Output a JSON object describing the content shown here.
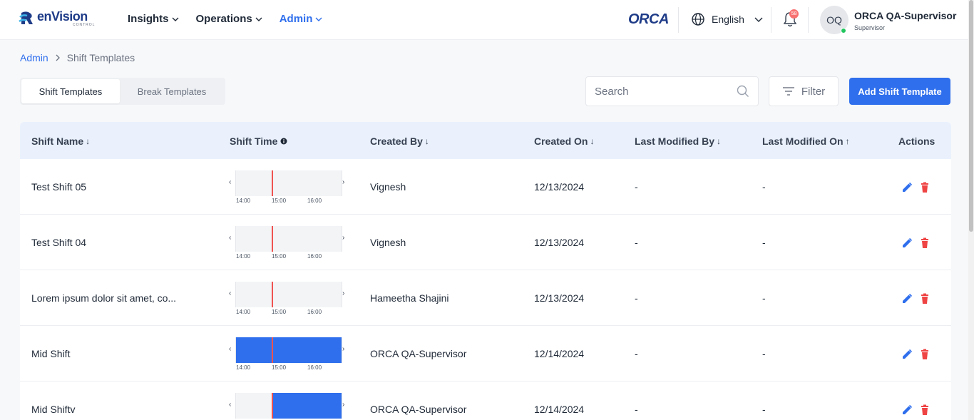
{
  "header": {
    "brand_name": "enVision",
    "brand_sub": "CONTROL",
    "nav": [
      "Insights",
      "Operations",
      "Admin"
    ],
    "partner_logo": "ORCA",
    "language": "English",
    "notification_count": "58",
    "user": {
      "initials": "OQ",
      "name": "ORCA QA-Supervisor",
      "role": "Supervisor"
    }
  },
  "breadcrumb": {
    "parent": "Admin",
    "current": "Shift Templates"
  },
  "tabs": [
    "Shift Templates",
    "Break Templates"
  ],
  "search": {
    "placeholder": "Search"
  },
  "filter_label": "Filter",
  "add_button": "Add Shift Template",
  "table": {
    "columns": [
      {
        "label": "Shift Name",
        "sort": "↓"
      },
      {
        "label": "Shift Time",
        "sort": ""
      },
      {
        "label": "Created By",
        "sort": "↓"
      },
      {
        "label": "Created On",
        "sort": "↓"
      },
      {
        "label": "Last Modified By",
        "sort": "↓"
      },
      {
        "label": "Last Modified On",
        "sort": "↑"
      },
      {
        "label": "Actions",
        "sort": ""
      }
    ],
    "timeline_ticks": [
      "14:00",
      "15:00",
      "16:00"
    ],
    "rows": [
      {
        "name": "Test Shift 05",
        "created_by": "Vignesh",
        "created_on": "12/13/2024",
        "modified_by": "-",
        "modified_on": "-",
        "shift_fill": "none"
      },
      {
        "name": "Test Shift 04",
        "created_by": "Vignesh",
        "created_on": "12/13/2024",
        "modified_by": "-",
        "modified_on": "-",
        "shift_fill": "none"
      },
      {
        "name": "Lorem ipsum dolor sit amet, co...",
        "created_by": "Hameetha Shajini",
        "created_on": "12/13/2024",
        "modified_by": "-",
        "modified_on": "-",
        "shift_fill": "none"
      },
      {
        "name": "Mid Shift",
        "created_by": "ORCA QA-Supervisor",
        "created_on": "12/14/2024",
        "modified_by": "-",
        "modified_on": "-",
        "shift_fill": "full"
      },
      {
        "name": "Mid Shiftv",
        "created_by": "ORCA QA-Supervisor",
        "created_on": "12/14/2024",
        "modified_by": "-",
        "modified_on": "-",
        "shift_fill": "from-now"
      }
    ]
  },
  "colors": {
    "accent": "#2f6fed",
    "header_bg": "#eaf1fd",
    "delete": "#ef4444",
    "now_line": "#ef5350"
  }
}
